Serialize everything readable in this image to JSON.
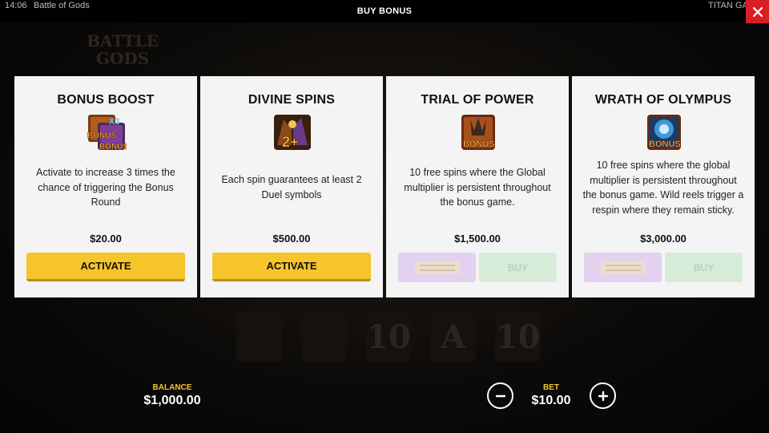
{
  "topbar": {
    "time": "14:06",
    "game_title": "Battle of Gods",
    "title": "BUY BONUS",
    "provider": "TITAN GA"
  },
  "background": {
    "logo_line1": "BATTLE",
    "logo_line2": "GODS",
    "symbols": [
      "",
      "",
      "10",
      "A",
      "10"
    ]
  },
  "cards": [
    {
      "title": "BONUS BOOST",
      "icon": "bonus-boost-x3-icon",
      "icon_text": "X3",
      "icon_badge": "BONUS",
      "description": "Activate to increase 3 times the chance of triggering the Bonus Round",
      "price": "$20.00",
      "button_label": "ACTIVATE"
    },
    {
      "title": "DIVINE SPINS",
      "icon": "divine-spins-icon",
      "icon_text": "2+",
      "description": "Each spin guarantees at least 2 Duel symbols",
      "price": "$500.00",
      "button_label": "ACTIVATE"
    },
    {
      "title": "TRIAL OF POWER",
      "icon": "trial-of-power-icon",
      "icon_badge": "BONUS",
      "description": "10 free spins where the Global multiplier is persistent throughout the bonus game.",
      "price": "$1,500.00",
      "buy_label": "BUY"
    },
    {
      "title": "WRATH OF OLYMPUS",
      "icon": "wrath-of-olympus-icon",
      "icon_badge": "BONUS",
      "description": "10 free spins where the global multiplier is persistent throughout the bonus game. Wild reels trigger a respin where they remain sticky.",
      "price": "$3,000.00",
      "buy_label": "BUY"
    }
  ],
  "footer": {
    "balance_label": "BALANCE",
    "balance_value": "$1,000.00",
    "bet_label": "BET",
    "bet_value": "$10.00"
  },
  "colors": {
    "accent": "#f6c52b",
    "close": "#d81f26",
    "card_bg": "#f4f4f4",
    "disabled_special": "#e3d2ef",
    "disabled_buy": "#d6ecd9"
  }
}
